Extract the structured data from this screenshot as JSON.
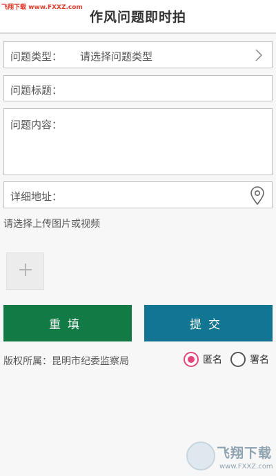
{
  "header": {
    "title": "作风问题即时拍",
    "watermark": "飞翔下载 www.FXXZ.com"
  },
  "form": {
    "type_label": "问题类型：",
    "type_value": "请选择问题类型",
    "title_label": "问题标题：",
    "content_label": "问题内容：",
    "address_label": "详细地址：",
    "upload_hint": "请选择上传图片或视频"
  },
  "buttons": {
    "reset": "重填",
    "submit": "提交"
  },
  "footer": {
    "copyright": "版权所属：昆明市纪委监察局",
    "anonymous": "匿名",
    "named": "署名"
  },
  "watermark_logo": {
    "brand": "飞翔下载",
    "url": "www.FXXZ.com"
  },
  "colors": {
    "reset_button": "#127a44",
    "submit_button": "#127693",
    "radio_selected": "#e5457a"
  },
  "icons": {
    "type_field": "chevron-right-icon",
    "address_field": "location-pin-icon",
    "upload": "plus-icon"
  },
  "state": {
    "anonymous_selected": true
  }
}
